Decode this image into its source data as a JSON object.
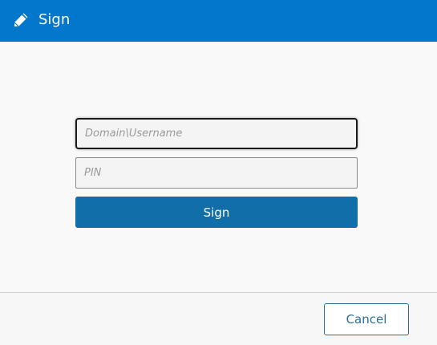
{
  "dialog": {
    "title": "Sign",
    "title_icon": "pencil-icon",
    "header_color": "#0277cc"
  },
  "form": {
    "username_placeholder": "Domain\\Username",
    "username_value": "",
    "pin_placeholder": "PIN",
    "pin_value": "",
    "sign_label": "Sign",
    "sign_color": "#116ea8"
  },
  "footer": {
    "cancel_label": "Cancel"
  }
}
